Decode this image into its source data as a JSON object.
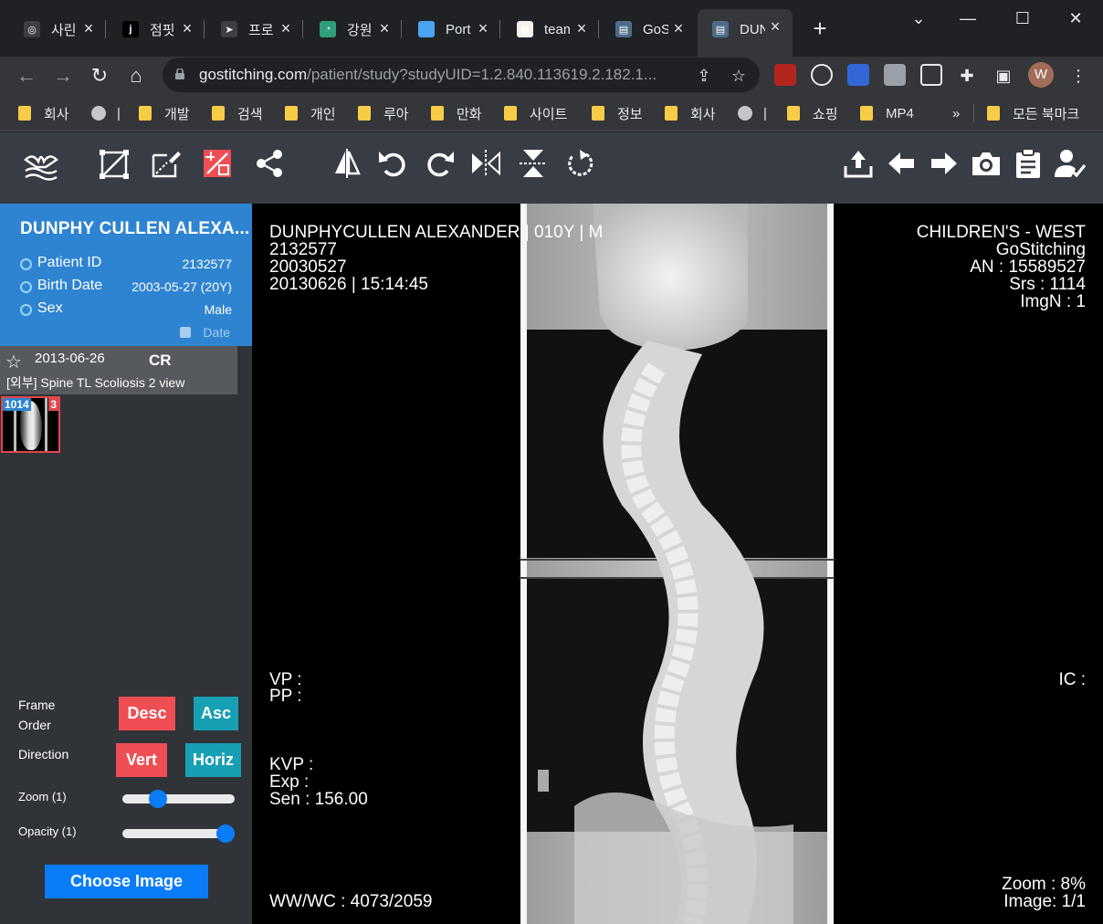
{
  "browser": {
    "tabs": [
      {
        "title": "사린",
        "fav_bg": "#3c4043",
        "fav_text": "◎"
      },
      {
        "title": "점핏",
        "fav_bg": "#000000",
        "fav_text": "j"
      },
      {
        "title": "프로",
        "fav_bg": "#3c4043",
        "fav_text": "➤"
      },
      {
        "title": "강원",
        "fav_bg": "#2f9e7a",
        "fav_text": "◔"
      },
      {
        "title": "Port",
        "fav_bg": "#4aa3f0",
        "fav_text": ""
      },
      {
        "title": "team",
        "fav_bg": "#f4f1ec",
        "fav_text": "▦"
      },
      {
        "title": "GoS",
        "fav_bg": "#4f6b8a",
        "fav_text": "▤"
      },
      {
        "title": "DUN",
        "fav_bg": "#4f6b8a",
        "fav_text": "▤"
      }
    ],
    "url_host": "gostitching.com",
    "url_path": "/patient/study?studyUID=1.2.840.113619.2.182.1...",
    "avatar_letter": "W",
    "bookmarks": [
      {
        "label": "회사",
        "kind": "folder"
      },
      {
        "label": "|",
        "kind": "globe"
      },
      {
        "label": "개발",
        "kind": "folder"
      },
      {
        "label": "검색",
        "kind": "folder"
      },
      {
        "label": "개인",
        "kind": "folder"
      },
      {
        "label": "루아",
        "kind": "folder"
      },
      {
        "label": "만화",
        "kind": "folder"
      },
      {
        "label": "사이트",
        "kind": "folder"
      },
      {
        "label": "정보",
        "kind": "folder"
      },
      {
        "label": "회사",
        "kind": "folder"
      },
      {
        "label": "|",
        "kind": "globe"
      },
      {
        "label": "쇼핑",
        "kind": "folder"
      },
      {
        "label": "MP4",
        "kind": "folder"
      }
    ],
    "bookmarks_overflow": "»",
    "all_bookmarks": "모든 북마크"
  },
  "patient": {
    "name": "DUNPHY CULLEN ALEXA...",
    "fields": [
      {
        "label": "Patient ID",
        "value": "2132577"
      },
      {
        "label": "Birth Date",
        "value": "2003-05-27 (20Y)"
      },
      {
        "label": "Sex",
        "value": "Male"
      }
    ],
    "date_label": "Date"
  },
  "study": {
    "date": "2013-06-26",
    "modality": "CR",
    "description": "[외부] Spine TL Scoliosis 2 view",
    "thumb_number": "1014",
    "thumb_count": "3"
  },
  "controls": {
    "frame_order_label": "Frame\nOrder",
    "frame_order_line1": "Frame",
    "frame_order_line2": "Order",
    "desc": "Desc",
    "asc": "Asc",
    "direction_label": "Direction",
    "vert": "Vert",
    "horiz": "Horiz",
    "zoom_label": "Zoom (1)",
    "zoom_value_fraction": 0.28,
    "opacity_label": "Opacity (1)",
    "opacity_value_fraction": 1.0,
    "choose_image": "Choose Image"
  },
  "overlay": {
    "top_left": [
      "DUNPHYCULLEN ALEXANDER | 010Y | M",
      "2132577",
      "20030527",
      "20130626 | 15:14:45"
    ],
    "top_right": [
      "CHILDREN'S - WEST",
      "GoStitching",
      "AN : 15589527",
      "Srs : 1114",
      "ImgN : 1"
    ],
    "mid_left": [
      "VP :",
      "PP :"
    ],
    "mid_right": [
      "IC :"
    ],
    "lower_left": [
      "KVP :",
      "Exp :",
      "Sen : 156.00"
    ],
    "bottom_left": "WW/WC : 4073/2059",
    "bottom_right": [
      "Zoom : 8%",
      "Image: 1/1"
    ]
  },
  "colors": {
    "accent_blue": "#2e84d0",
    "button_red": "#ef4e55",
    "button_teal": "#179fb3",
    "primary_blue": "#0b7cf7",
    "app_toolbar": "#383c45"
  }
}
